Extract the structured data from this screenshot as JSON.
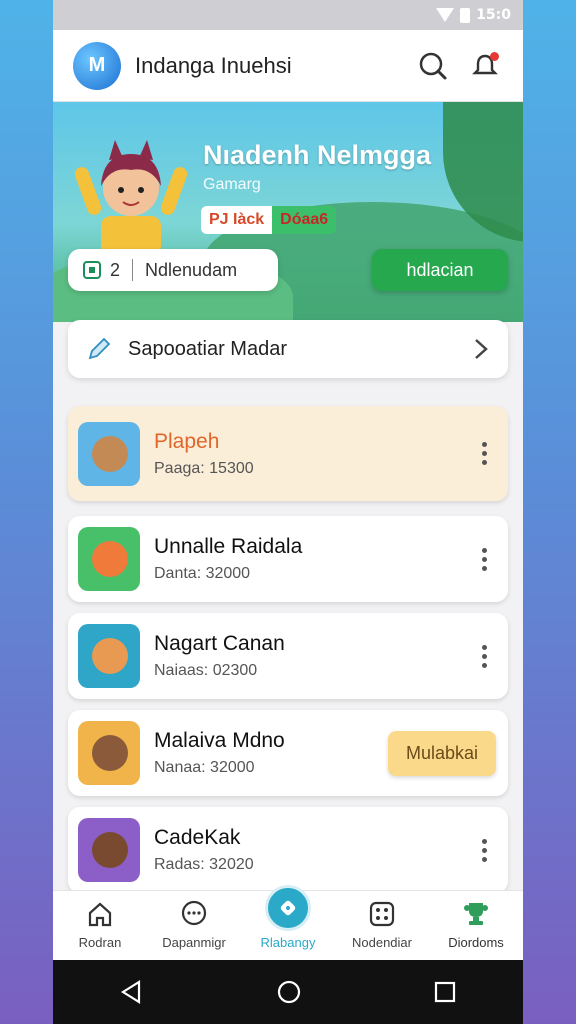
{
  "status_bar": {
    "time": "15:0"
  },
  "app_bar": {
    "title": "Indanga Inuehsi",
    "logo_text": "M"
  },
  "hero": {
    "title": "Nıadenh Nelmgga",
    "subtitle": "Gamarg",
    "chip_left": "PJ Iàck",
    "chip_right": "Dóaa6",
    "stat_count": "2",
    "stat_label": "Ndlenudam",
    "button_label": "hdlacian"
  },
  "search_card": {
    "label": "Sapooatiar Madar"
  },
  "games": [
    {
      "title": "Plapeh",
      "subtitle": "Paaga: 15300",
      "highlight": true,
      "thumb_bg": "#5fb6e6",
      "face": "#c48a56"
    },
    {
      "title": "Unnalle Raidala",
      "subtitle": "Danta: 32000",
      "highlight": false,
      "thumb_bg": "#48c06a",
      "face": "#f07a3a"
    },
    {
      "title": "Nagart Canan",
      "subtitle": "Naiaas: 02300",
      "highlight": false,
      "thumb_bg": "#2fa6c8",
      "face": "#e99a52"
    },
    {
      "title": "Malaiva Mdno",
      "subtitle": "Nanaa: 32000",
      "highlight": false,
      "thumb_bg": "#f0b44a",
      "face": "#8a5a3a",
      "action": "Mulabkai"
    },
    {
      "title": "CadeKak",
      "subtitle": "Radas: 32020",
      "highlight": false,
      "thumb_bg": "#8b5fc7",
      "face": "#7a4a30"
    }
  ],
  "bottom_nav": [
    {
      "label": "Rodran",
      "icon": "home-icon"
    },
    {
      "label": "Dapanmigr",
      "icon": "chat-icon"
    },
    {
      "label": "Rlabangy",
      "icon": "play-tag-icon",
      "active": true
    },
    {
      "label": "Nodendiar",
      "icon": "dice-icon"
    },
    {
      "label": "Diordoms",
      "icon": "trophy-icon"
    }
  ],
  "colors": {
    "accent": "#26a84f",
    "active_tab": "#2aa9c9",
    "highlight_row": "#fbeed8"
  }
}
